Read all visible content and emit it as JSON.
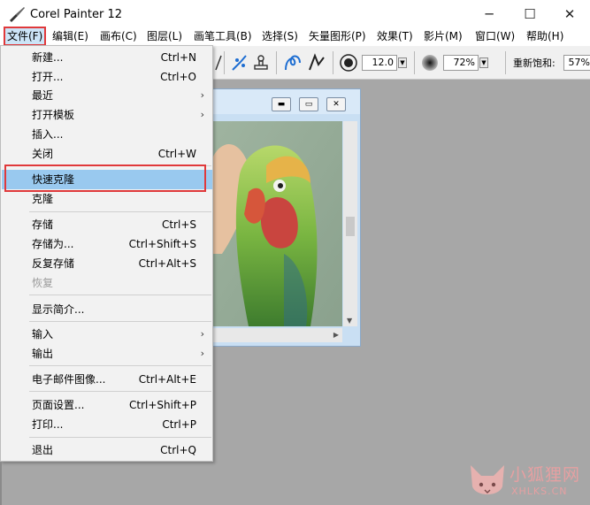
{
  "app": {
    "title": "Corel Painter 12",
    "minimize_glyph": "─",
    "maximize_glyph": "☐",
    "close_glyph": "✕"
  },
  "menubar": {
    "items": [
      {
        "label": "文件(F)"
      },
      {
        "label": "编辑(E)"
      },
      {
        "label": "画布(C)"
      },
      {
        "label": "图层(L)"
      },
      {
        "label": "画笔工具(B)"
      },
      {
        "label": "选择(S)"
      },
      {
        "label": "矢量图形(P)"
      },
      {
        "label": "效果(T)"
      },
      {
        "label": "影片(M)"
      },
      {
        "label": "窗口(W)"
      },
      {
        "label": "帮助(H)"
      }
    ]
  },
  "toolbar": {
    "size_value": "12.0",
    "opacity_value": "72%",
    "resaturation_label": "重新饱和:",
    "resaturation_value": "57%"
  },
  "file_menu": {
    "items": [
      {
        "label": "新建...",
        "shortcut": "Ctrl+N"
      },
      {
        "label": "打开...",
        "shortcut": "Ctrl+O"
      },
      {
        "label": "最近",
        "shortcut": ""
      },
      {
        "label": "打开模板",
        "shortcut": ""
      },
      {
        "label": "插入...",
        "shortcut": ""
      },
      {
        "label": "关闭",
        "shortcut": "Ctrl+W"
      },
      {
        "label": "快速克隆",
        "shortcut": ""
      },
      {
        "label": "克隆",
        "shortcut": ""
      },
      {
        "label": "存储",
        "shortcut": "Ctrl+S"
      },
      {
        "label": "存储为...",
        "shortcut": "Ctrl+Shift+S"
      },
      {
        "label": "反复存储",
        "shortcut": "Ctrl+Alt+S"
      },
      {
        "label": "恢复",
        "shortcut": ""
      },
      {
        "label": "显示简介...",
        "shortcut": ""
      },
      {
        "label": "输入",
        "shortcut": ""
      },
      {
        "label": "输出",
        "shortcut": ""
      },
      {
        "label": "电子邮件图像...",
        "shortcut": "Ctrl+Alt+E"
      },
      {
        "label": "页面设置...",
        "shortcut": "Ctrl+Shift+P"
      },
      {
        "label": "打印...",
        "shortcut": "Ctrl+P"
      },
      {
        "label": "退出",
        "shortcut": "Ctrl+Q"
      }
    ],
    "submenu_glyph": "›"
  },
  "watermark": {
    "text": "小狐狸网",
    "sub": "XHLKS.CN"
  },
  "colors": {
    "highlight": "#99c9ef",
    "annotation_red": "#e0393b",
    "workspace": "#a7a7a7"
  }
}
